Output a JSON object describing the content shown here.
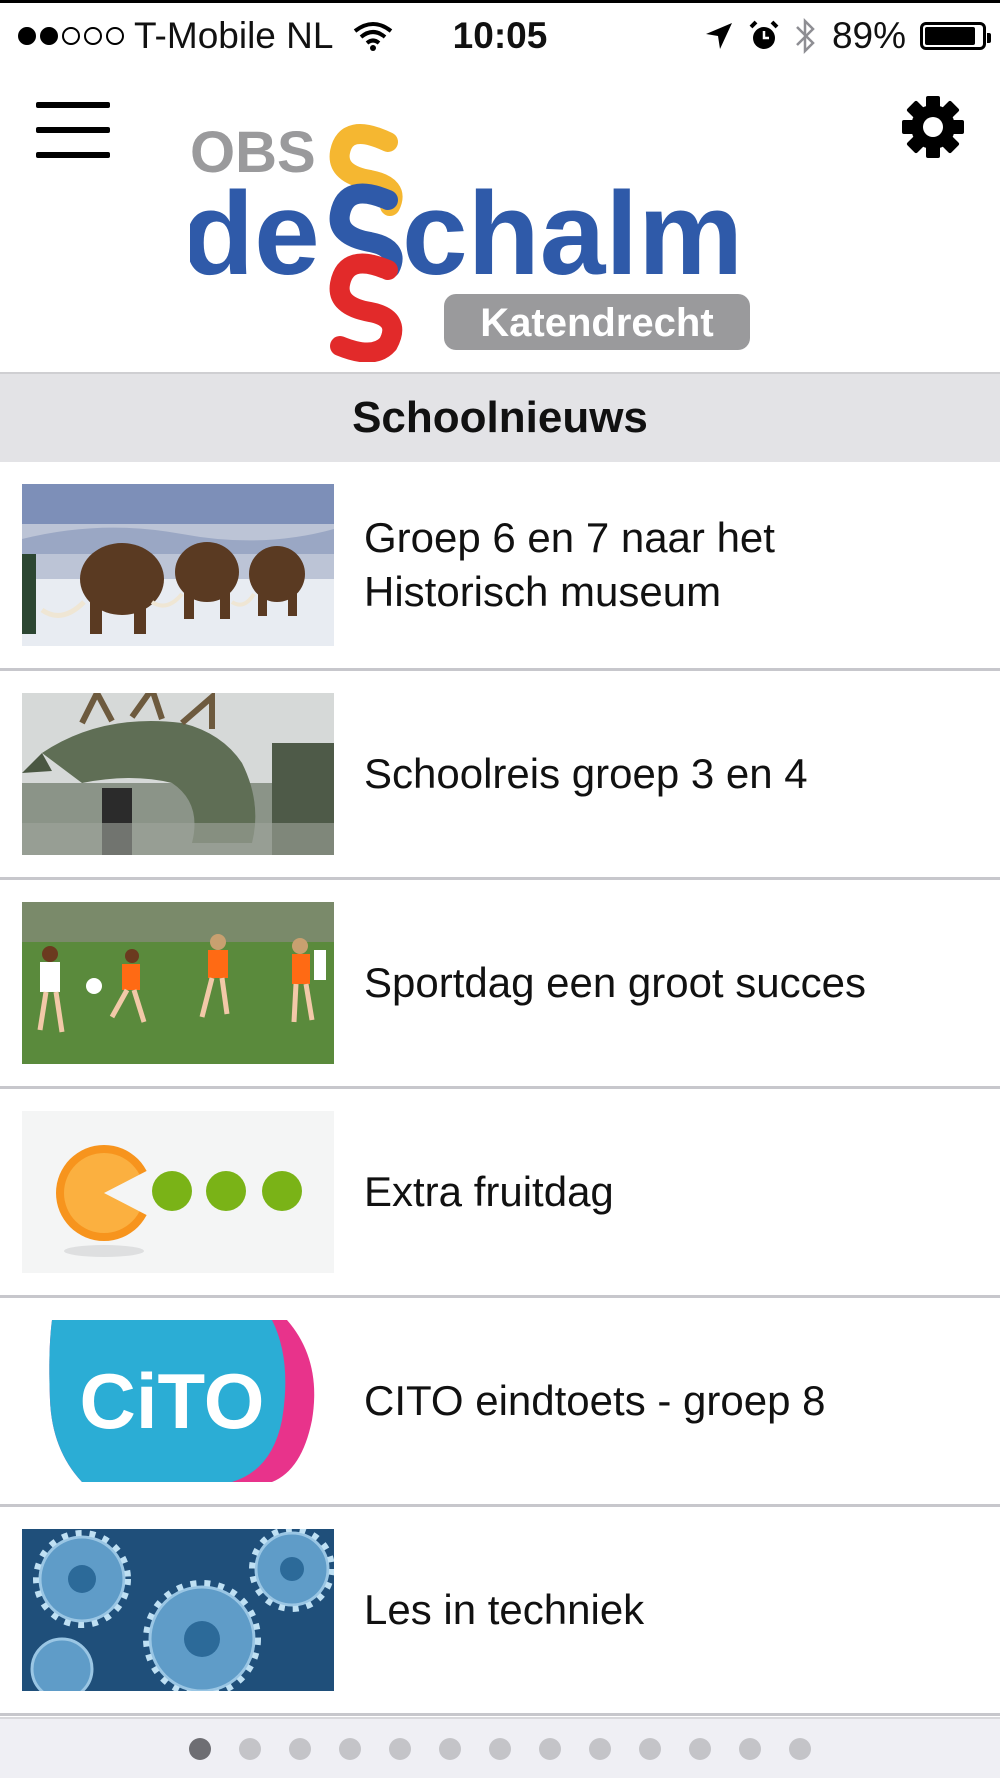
{
  "status_bar": {
    "signal_filled": 2,
    "signal_total": 5,
    "carrier": "T-Mobile NL",
    "time": "10:05",
    "battery_percent": "89%",
    "battery_level": 0.89,
    "icons": [
      "wifi-icon",
      "location-arrow-icon",
      "alarm-icon",
      "bluetooth-icon",
      "battery-icon"
    ]
  },
  "header": {
    "menu_icon": "hamburger-menu-icon",
    "settings_icon": "gear-icon",
    "logo": {
      "obs": "OBS",
      "de": "de",
      "chalm": "chalm",
      "katendrecht": "Katendrecht",
      "colors": {
        "grey": "#9a9a9c",
        "blue": "#2f5aa9",
        "yellow": "#f5b731",
        "red": "#e22a2a"
      }
    }
  },
  "section": {
    "title": "Schoolnieuws"
  },
  "news": [
    {
      "title_line1": "Groep 6 en 7 naar het",
      "title_line2": "Historisch museum",
      "image": "mammoths-image"
    },
    {
      "title_line1": "Schoolreis groep 3 en 4",
      "title_line2": "",
      "image": "dragon-sculpture-image"
    },
    {
      "title_line1": "Sportdag een groot succes",
      "title_line2": "",
      "image": "football-girls-image"
    },
    {
      "title_line1": "Extra fruitdag",
      "title_line2": "",
      "image": "orange-limes-image"
    },
    {
      "title_line1": "CITO eindtoets - groep 8",
      "title_line2": "",
      "image": "cito-logo-image"
    },
    {
      "title_line1": "Les in techniek",
      "title_line2": "",
      "image": "gears-image"
    }
  ],
  "cito_logo_text": "CiTO",
  "pager": {
    "total_pages": 13,
    "active_index": 0
  }
}
